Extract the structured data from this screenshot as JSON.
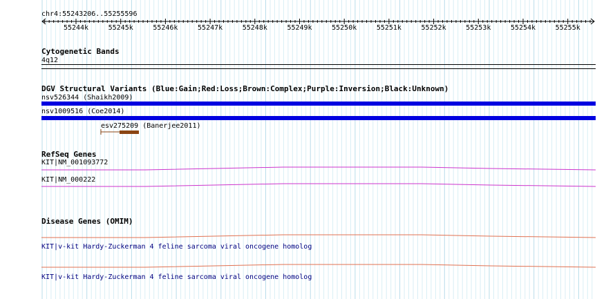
{
  "ruler": {
    "range_label": "chr4:55243206..55255596",
    "ticks": [
      "55244k",
      "55245k",
      "55246k",
      "55247k",
      "55248k",
      "55249k",
      "55250k",
      "55251k",
      "55252k",
      "55253k",
      "55254k",
      "55255k"
    ]
  },
  "tracks": {
    "cytoband": {
      "title": "Cytogenetic Bands",
      "band_label": "4q12"
    },
    "dgv": {
      "title": "DGV Structural Variants (Blue:Gain;Red:Loss;Brown:Complex;Purple:Inversion;Black:Unknown)",
      "variants": [
        {
          "id": "nsv526344",
          "source": "(Shaikh2009)",
          "label": "nsv526344 (Shaikh2009)",
          "color": "#0000e0"
        },
        {
          "id": "nsv1009516",
          "source": "(Coe2014)",
          "label": "nsv1009516 (Coe2014)",
          "color": "#0000e0"
        },
        {
          "id": "esv275209",
          "source": "(Banerjee2011)",
          "label": "esv275209 (Banerjee2011)",
          "color": "#8b4513"
        }
      ]
    },
    "refseq": {
      "title": "RefSeq Genes",
      "genes": [
        {
          "label": "KIT|NM_001093772",
          "color": "#cc33cc"
        },
        {
          "label": "KIT|NM_000222",
          "color": "#cc33cc"
        }
      ]
    },
    "omim": {
      "title": "Disease Genes (OMIM)",
      "genes": [
        {
          "label": "KIT|v-kit Hardy-Zuckerman 4 feline sarcoma viral oncogene homolog",
          "color": "#e07050"
        },
        {
          "label": "KIT|v-kit Hardy-Zuckerman 4 feline sarcoma viral oncogene homolog",
          "color": "#e07050"
        }
      ]
    }
  }
}
